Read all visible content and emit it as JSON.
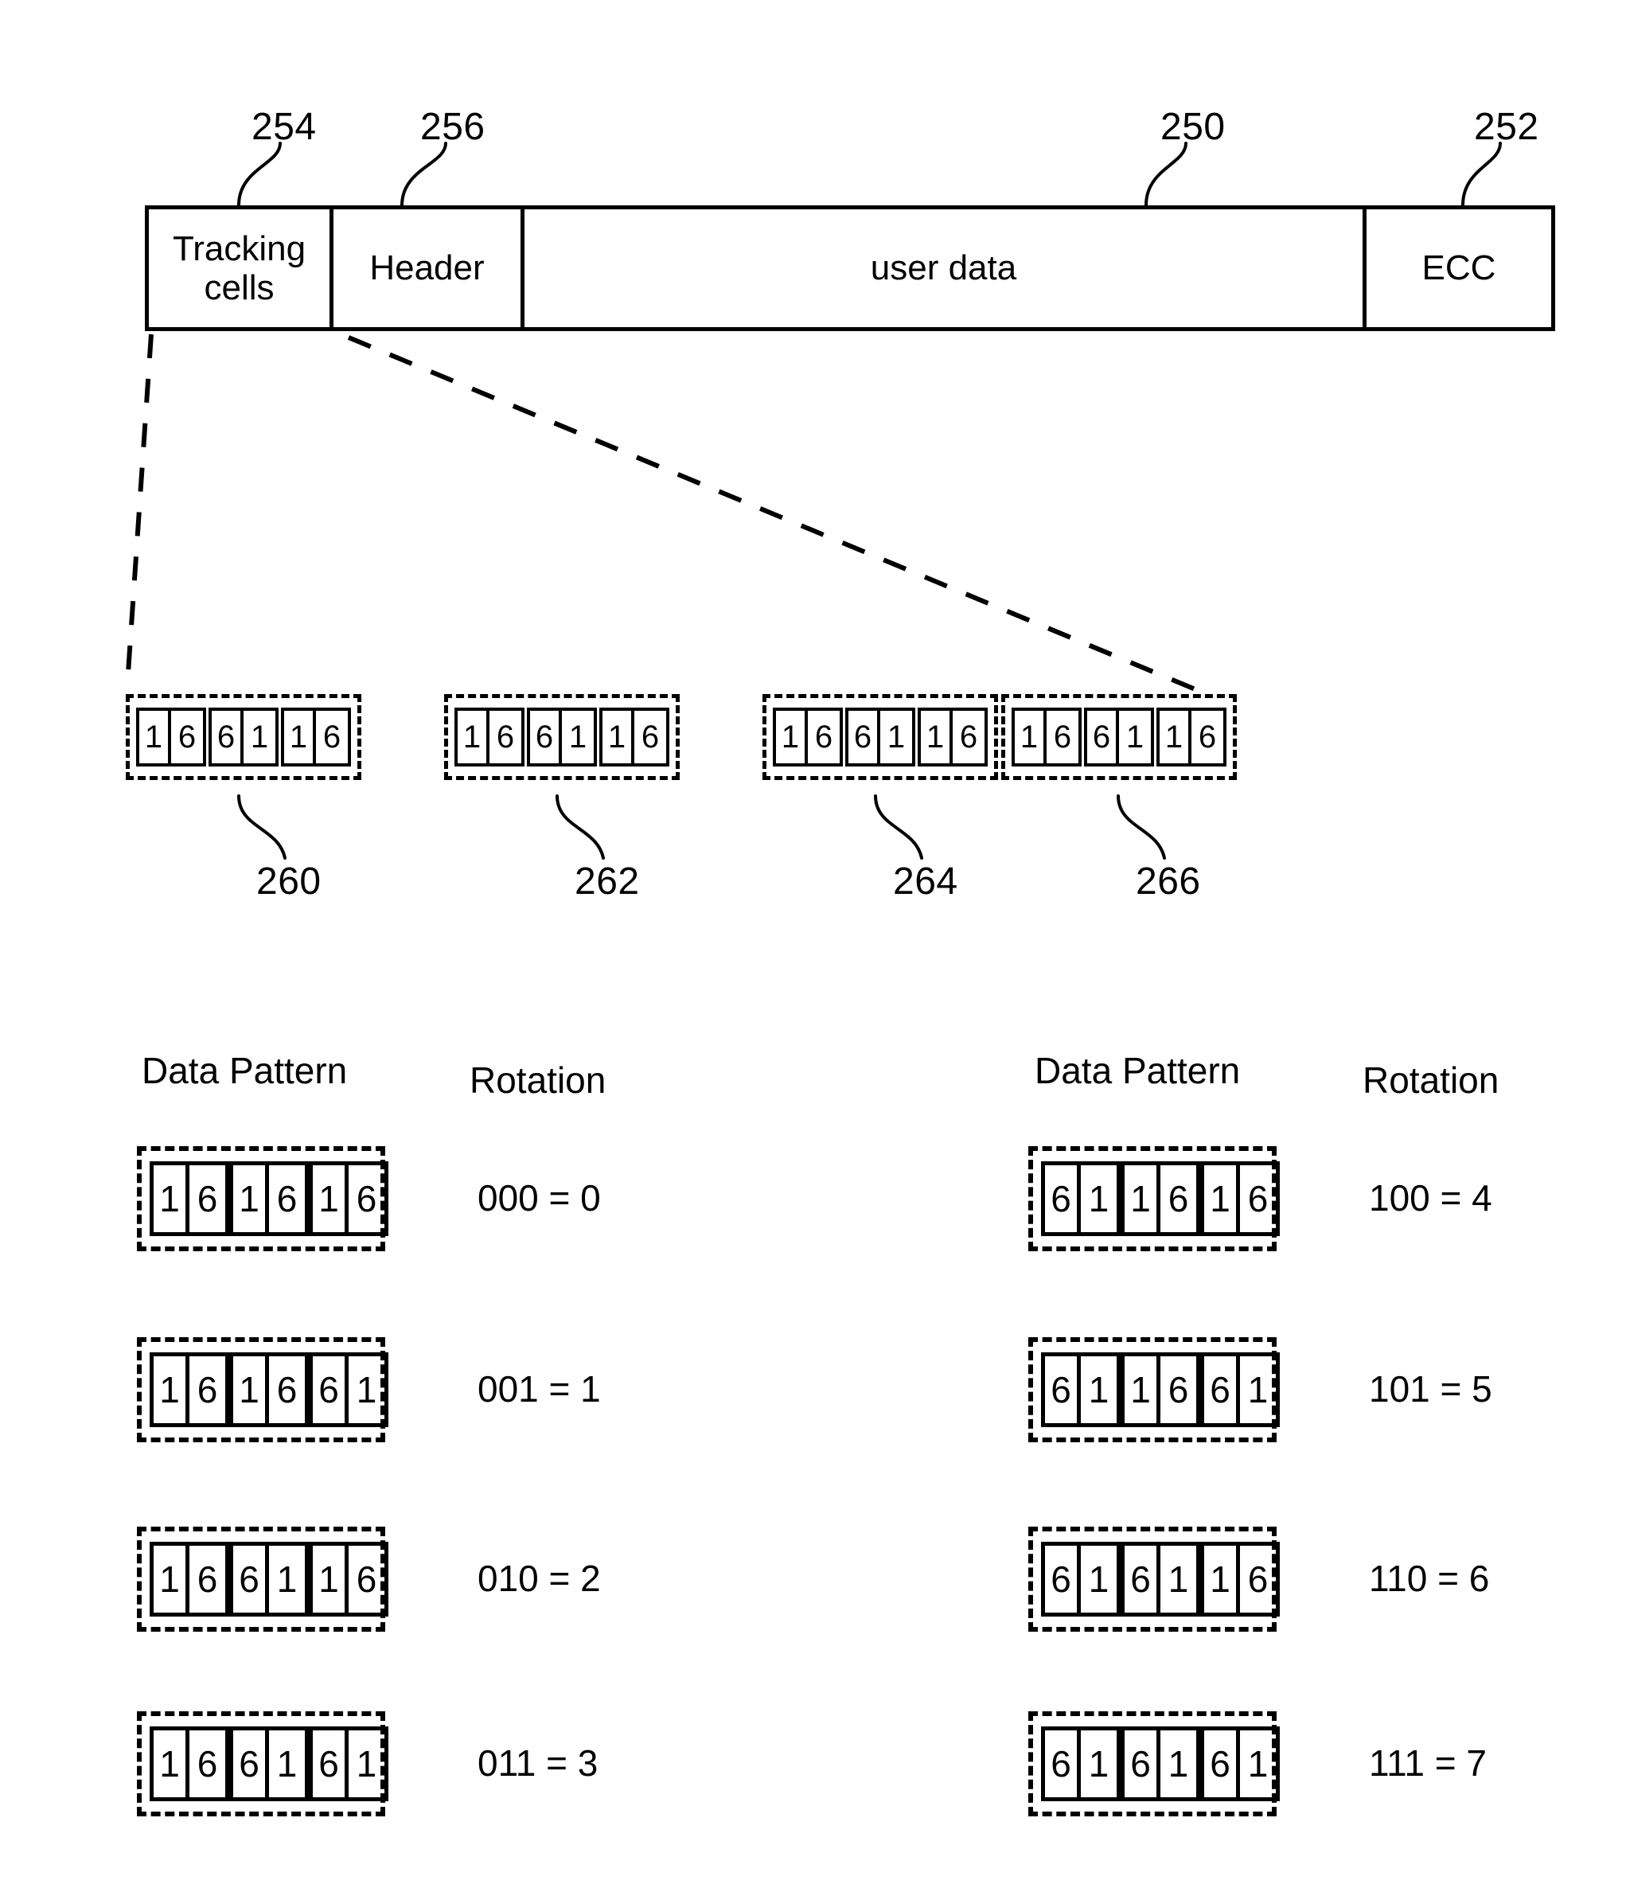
{
  "figure": {
    "sector_bar": {
      "cells": [
        {
          "label": "Tracking\ncells",
          "ref": "254"
        },
        {
          "label": "Header",
          "ref": "256"
        },
        {
          "label": "user data",
          "ref": "250"
        },
        {
          "label": "ECC",
          "ref": "252"
        }
      ]
    },
    "tracking_groups": [
      {
        "ref": "260",
        "pairs": [
          [
            "1",
            "6"
          ],
          [
            "6",
            "1"
          ],
          [
            "1",
            "6"
          ]
        ]
      },
      {
        "ref": "262",
        "pairs": [
          [
            "1",
            "6"
          ],
          [
            "6",
            "1"
          ],
          [
            "1",
            "6"
          ]
        ]
      },
      {
        "ref": "264",
        "pairs": [
          [
            "1",
            "6"
          ],
          [
            "6",
            "1"
          ],
          [
            "1",
            "6"
          ]
        ]
      },
      {
        "ref": "266",
        "pairs": [
          [
            "1",
            "6"
          ],
          [
            "6",
            "1"
          ],
          [
            "1",
            "6"
          ]
        ]
      }
    ],
    "table": {
      "headers": {
        "pattern": "Data Pattern",
        "rotation": "Rotation"
      },
      "left_rows": [
        {
          "pairs": [
            [
              "1",
              "6"
            ],
            [
              "1",
              "6"
            ],
            [
              "1",
              "6"
            ]
          ],
          "rotation": "000 = 0"
        },
        {
          "pairs": [
            [
              "1",
              "6"
            ],
            [
              "1",
              "6"
            ],
            [
              "6",
              "1"
            ]
          ],
          "rotation": "001 = 1"
        },
        {
          "pairs": [
            [
              "1",
              "6"
            ],
            [
              "6",
              "1"
            ],
            [
              "1",
              "6"
            ]
          ],
          "rotation": "010 = 2"
        },
        {
          "pairs": [
            [
              "1",
              "6"
            ],
            [
              "6",
              "1"
            ],
            [
              "6",
              "1"
            ]
          ],
          "rotation": "011 = 3"
        }
      ],
      "right_rows": [
        {
          "pairs": [
            [
              "6",
              "1"
            ],
            [
              "1",
              "6"
            ],
            [
              "1",
              "6"
            ]
          ],
          "rotation": "100 = 4"
        },
        {
          "pairs": [
            [
              "6",
              "1"
            ],
            [
              "1",
              "6"
            ],
            [
              "6",
              "1"
            ]
          ],
          "rotation": "101 = 5"
        },
        {
          "pairs": [
            [
              "6",
              "1"
            ],
            [
              "6",
              "1"
            ],
            [
              "1",
              "6"
            ]
          ],
          "rotation": "110 = 6"
        },
        {
          "pairs": [
            [
              "6",
              "1"
            ],
            [
              "6",
              "1"
            ],
            [
              "6",
              "1"
            ]
          ],
          "rotation": "111 = 7"
        }
      ]
    }
  },
  "colors": {
    "ink": "#000000",
    "paper": "#ffffff"
  }
}
